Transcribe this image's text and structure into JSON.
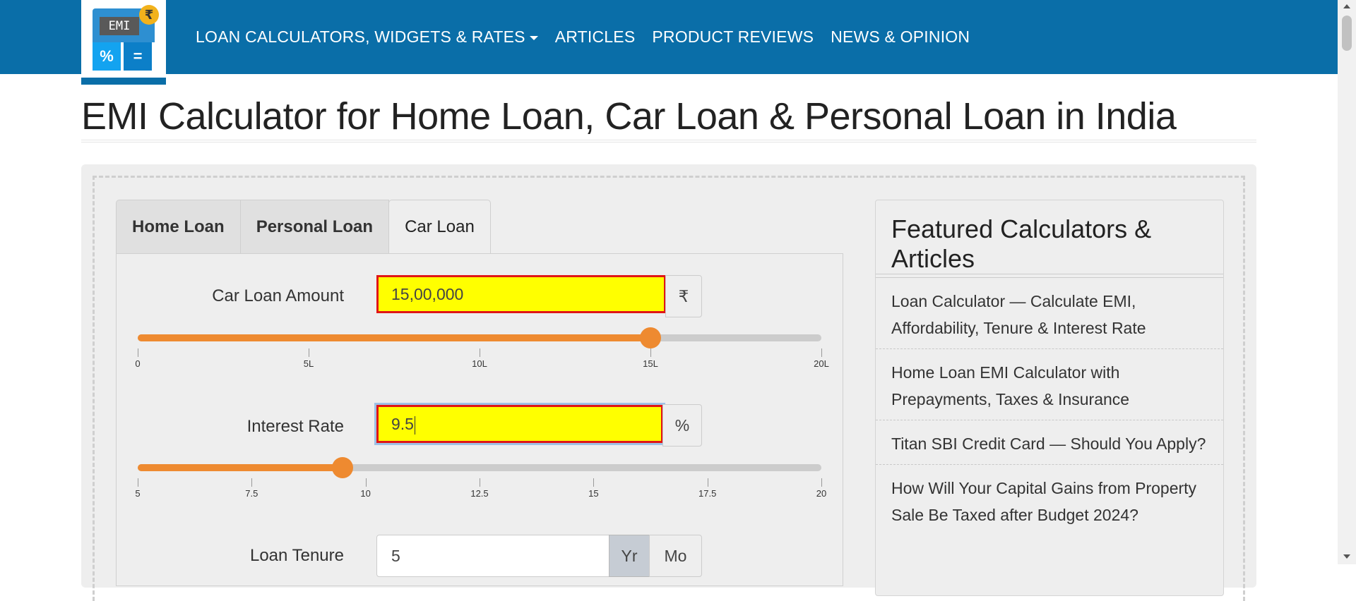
{
  "logo": {
    "screen_text": "EMI",
    "coin_symbol": "₹",
    "key_left": "%",
    "key_right": "="
  },
  "nav": {
    "items": [
      {
        "label": "LOAN CALCULATORS, WIDGETS & RATES",
        "has_dropdown": true
      },
      {
        "label": "ARTICLES"
      },
      {
        "label": "PRODUCT REVIEWS"
      },
      {
        "label": "NEWS & OPINION"
      }
    ]
  },
  "page": {
    "title": "EMI Calculator for Home Loan, Car Loan & Personal Loan in India"
  },
  "tabs": [
    {
      "label": "Home Loan",
      "active": false
    },
    {
      "label": "Personal Loan",
      "active": false
    },
    {
      "label": "Car Loan",
      "active": true
    }
  ],
  "loan_amount": {
    "label": "Car Loan Amount",
    "value": "15,00,000",
    "unit": "₹",
    "slider": {
      "min": 0,
      "max": 20,
      "value": 15,
      "tick_labels": [
        "0",
        "5L",
        "10L",
        "15L",
        "20L"
      ]
    }
  },
  "interest_rate": {
    "label": "Interest Rate",
    "value": "9.5",
    "unit": "%",
    "slider": {
      "min": 5,
      "max": 20,
      "value": 9.5,
      "tick_labels": [
        "5",
        "7.5",
        "10",
        "12.5",
        "15",
        "17.5",
        "20"
      ]
    }
  },
  "loan_tenure": {
    "label": "Loan Tenure",
    "value": "5",
    "unit_year": "Yr",
    "unit_month": "Mo",
    "selected_unit": "Yr"
  },
  "sidebar": {
    "heading": "Featured Calculators & Articles",
    "items": [
      "Loan Calculator — Calculate EMI, Affordability, Tenure & Interest Rate",
      "Home Loan EMI Calculator with Prepayments, Taxes & Insurance",
      "Titan SBI Credit Card — Should You Apply?",
      "How Will Your Capital Gains from Property Sale Be Taxed after Budget 2024?"
    ]
  },
  "colors": {
    "nav_bg": "#0a6ea8",
    "slider_fill": "#ee8a30",
    "input_highlight": "#ffff00",
    "input_error_border": "#e01616"
  }
}
